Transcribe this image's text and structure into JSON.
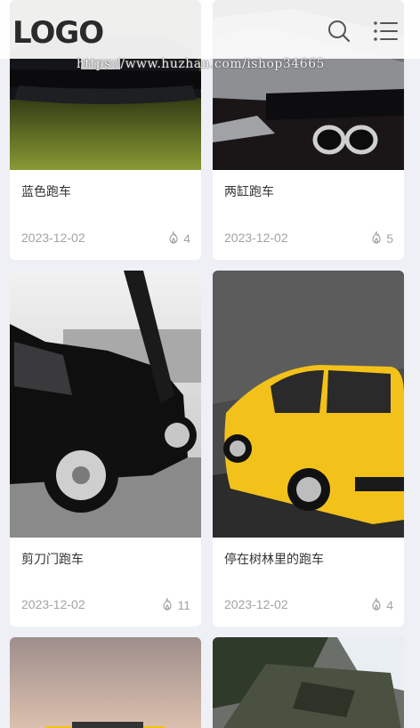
{
  "header": {
    "logo_text": "LOGO",
    "search_icon": "search-icon",
    "menu_icon": "list-menu-icon"
  },
  "watermark": "https://www.huzhan.com/ishop34665",
  "cards": [
    {
      "title": "蓝色跑车",
      "date": "2023-12-02",
      "hot": "4"
    },
    {
      "title": "两缸跑车",
      "date": "2023-12-02",
      "hot": "5"
    },
    {
      "title": "剪刀门跑车",
      "date": "2023-12-02",
      "hot": "11"
    },
    {
      "title": "停在树林里的跑车",
      "date": "2023-12-02",
      "hot": "4"
    },
    {
      "title": "",
      "date": "",
      "hot": ""
    },
    {
      "title": "",
      "date": "",
      "hot": ""
    }
  ],
  "colors": {
    "background": "#eef0f6",
    "card": "#ffffff",
    "title": "#333333",
    "meta": "#a3a3a3"
  }
}
